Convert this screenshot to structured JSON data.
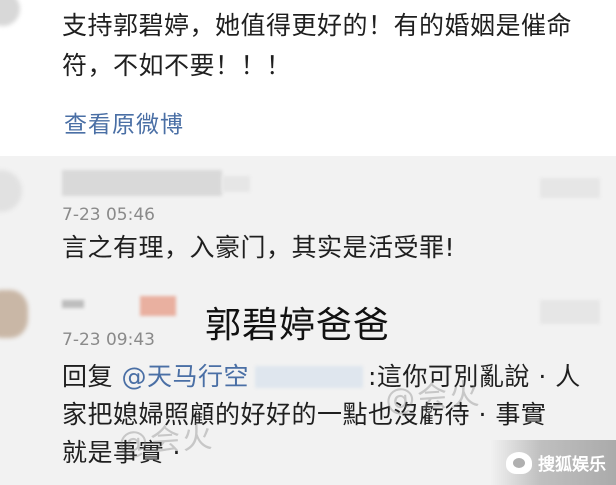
{
  "comment_1": {
    "line1": "支持郭碧婷，她值得更好的！有的婚姻是催命",
    "line2": "符，不如不要！！！",
    "view_original": "查看原微博"
  },
  "reply_1": {
    "time": "7-23 05:46",
    "text": "言之有理，入豪门，其实是活受罪!"
  },
  "reply_2": {
    "time": "7-23 09:43",
    "reply_prefix": "回复",
    "mention": "@天马行空",
    "line1_rest": ":這你可別亂說 · 人",
    "line2": "家把媳婦照顧的好好的一點也沒虧待 · 事實",
    "line3": "就是事實 ·"
  },
  "overlay_label": "郭碧婷爸爸",
  "watermark": "@会火",
  "logo_text": "搜狐娱乐",
  "colors": {
    "link": "#4a6fa5",
    "text": "#1f1f1f",
    "time": "#8a8a8a",
    "background_lower": "#f2f2f2"
  }
}
